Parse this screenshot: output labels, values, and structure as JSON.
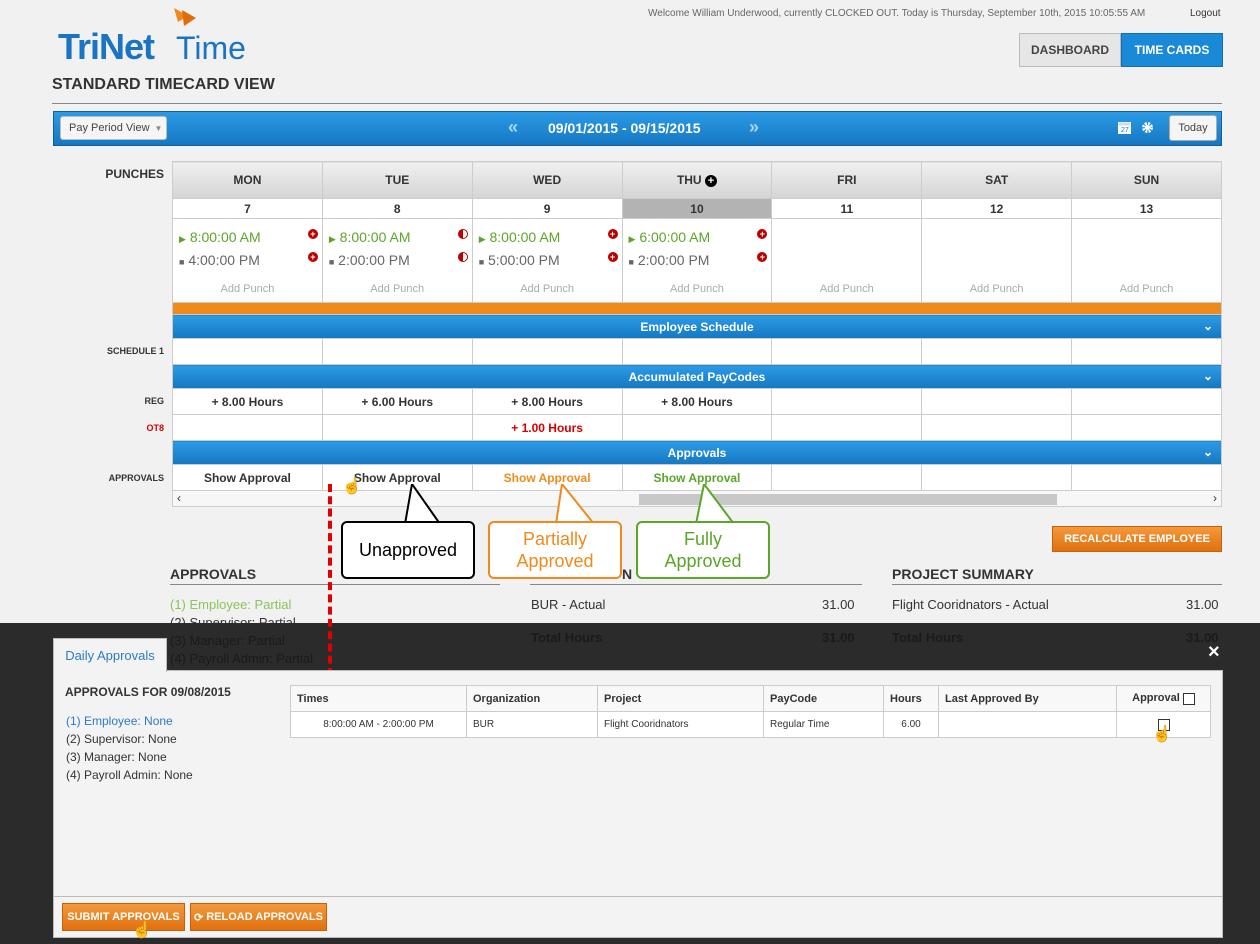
{
  "header": {
    "logo_trinet": "TriNet",
    "logo_time": "Time",
    "welcome": "Welcome William Underwood, currently CLOCKED OUT. Today is Thursday, September 10th, 2015 10:05:55 AM",
    "logout": "Logout",
    "dashboard": "DASHBOARD",
    "timecards": "TIME CARDS"
  },
  "page_title": "STANDARD TIMECARD VIEW",
  "toolbar": {
    "pay_period_view": "Pay Period View",
    "date_range": "09/01/2015 - 09/15/2015",
    "prev": "«",
    "next": "»",
    "today": "Today"
  },
  "row_labels": {
    "punches": "PUNCHES",
    "schedule": "SCHEDULE 1",
    "reg": "REG",
    "ot8": "OT8",
    "approvals": "APPROVALS"
  },
  "days": [
    {
      "name": "MON",
      "num": "7",
      "in": "8:00:00 AM",
      "out": "4:00:00 PM",
      "reg": "+ 8.00 Hours",
      "ot": "",
      "approval": "Show Approval"
    },
    {
      "name": "TUE",
      "num": "8",
      "in": "8:00:00 AM",
      "out": "2:00:00 PM",
      "reg": "+ 6.00 Hours",
      "ot": "",
      "approval": "Show Approval"
    },
    {
      "name": "WED",
      "num": "9",
      "in": "8:00:00 AM",
      "out": "5:00:00 PM",
      "reg": "+ 8.00 Hours",
      "ot": "+ 1.00 Hours",
      "approval": "Show Approval"
    },
    {
      "name": "THU",
      "num": "10",
      "in": "6:00:00 AM",
      "out": "2:00:00 PM",
      "reg": "+ 8.00 Hours",
      "ot": "",
      "approval": "Show Approval"
    },
    {
      "name": "FRI",
      "num": "11",
      "in": "",
      "out": "",
      "reg": "",
      "ot": "",
      "approval": ""
    },
    {
      "name": "SAT",
      "num": "12",
      "in": "",
      "out": "",
      "reg": "",
      "ot": "",
      "approval": ""
    },
    {
      "name": "SUN",
      "num": "13",
      "in": "",
      "out": "",
      "reg": "",
      "ot": "",
      "approval": ""
    }
  ],
  "add_punch": "Add Punch",
  "sections": {
    "schedule": "Employee Schedule",
    "paycodes": "Accumulated PayCodes",
    "approvals": "Approvals"
  },
  "callouts": {
    "unapproved": "Unapproved",
    "partial_1": "Partially",
    "partial_2": "Approved",
    "fully_1": "Fully",
    "fully_2": "Approved"
  },
  "recalculate": "RECALCULATE EMPLOYEE",
  "approvals_summary": {
    "title": "APPROVALS",
    "items": [
      "(1) Employee: Partial",
      "(2) Supervisor: Partial",
      "(3) Manager: Partial",
      "(4) Payroll Admin: Partial"
    ]
  },
  "org_summary": {
    "title_fragment": "N",
    "row_label": "BUR - Actual",
    "row_value": "31.00",
    "total_label": "Total Hours",
    "total_value": "31.00"
  },
  "project_summary": {
    "title": "PROJECT SUMMARY",
    "row_label": "Flight Cooridnators - Actual",
    "row_value": "31.00",
    "total_label": "Total Hours",
    "total_value": "31.00"
  },
  "panel": {
    "tab": "Daily Approvals",
    "close": "×",
    "title": "APPROVALS FOR 09/08/2015",
    "levels": [
      "(1) Employee: None",
      "(2) Supervisor: None",
      "(3) Manager: None",
      "(4) Payroll Admin: None"
    ],
    "columns": [
      "Times",
      "Organization",
      "Project",
      "PayCode",
      "Hours",
      "Last Approved By",
      "Approval"
    ],
    "rows": [
      {
        "times": "8:00:00 AM - 2:00:00 PM",
        "org": "BUR",
        "project": "Flight Cooridnators",
        "paycode": "Regular Time",
        "hours": "6.00",
        "last_by": ""
      }
    ],
    "submit": "SUBMIT APPROVALS",
    "reload": "RELOAD APPROVALS"
  },
  "colors": {
    "blue": "#1a8ad8",
    "orange": "#f08a1c",
    "green": "#5ba529",
    "red": "#d60000",
    "overlay": "#2b2b2b"
  }
}
